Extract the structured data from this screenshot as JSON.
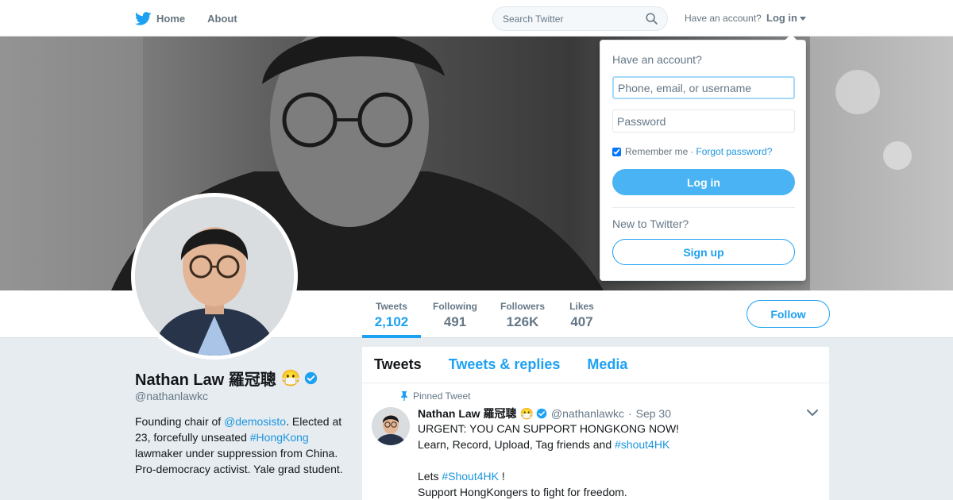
{
  "nav": {
    "home_label": "Home",
    "about_label": "About",
    "search_placeholder": "Search Twitter",
    "have_account": "Have an account?",
    "login_label": "Log in",
    "brand_color": "#1da1f2"
  },
  "profile": {
    "name": "Nathan Law 羅冠聰",
    "name_emoji": "😷",
    "handle": "@nathanlawkc",
    "bio": {
      "p1": "Founding chair of ",
      "mention": "@demosisto",
      "p2": ". Elected at 23, forcefully unseated ",
      "hashtag": "#HongKong",
      "p3": " lawmaker under suppression from China. Pro-democracy activist. Yale grad student."
    }
  },
  "stats": [
    {
      "label": "Tweets",
      "value": "2,102"
    },
    {
      "label": "Following",
      "value": "491"
    },
    {
      "label": "Followers",
      "value": "126K"
    },
    {
      "label": "Likes",
      "value": "407"
    }
  ],
  "follow_label": "Follow",
  "timeline": {
    "tabs": [
      "Tweets",
      "Tweets & replies",
      "Media"
    ],
    "pinned_label": "Pinned Tweet",
    "tweet": {
      "name": "Nathan Law 羅冠聰",
      "emoji": "😷",
      "handle": "@nathanlawkc",
      "sep": "·",
      "date": "Sep 30",
      "line1": "URGENT: YOU CAN SUPPORT HONGKONG NOW!",
      "line2": "Learn, Record, Upload, Tag friends and ",
      "line2_tag": "#shout4HK",
      "line3_pre": "Lets ",
      "line3_tag": "#Shout4HK",
      "line3_post": " !",
      "line4": "Support HongKongers to fight for freedom."
    }
  },
  "login_dropdown": {
    "title": "Have an account?",
    "user_placeholder": "Phone, email, or username",
    "password_placeholder": "Password",
    "remember": "Remember me",
    "sep": "·",
    "forgot": "Forgot password?",
    "login_button": "Log in",
    "new_to": "New to Twitter?",
    "signup_button": "Sign up"
  }
}
